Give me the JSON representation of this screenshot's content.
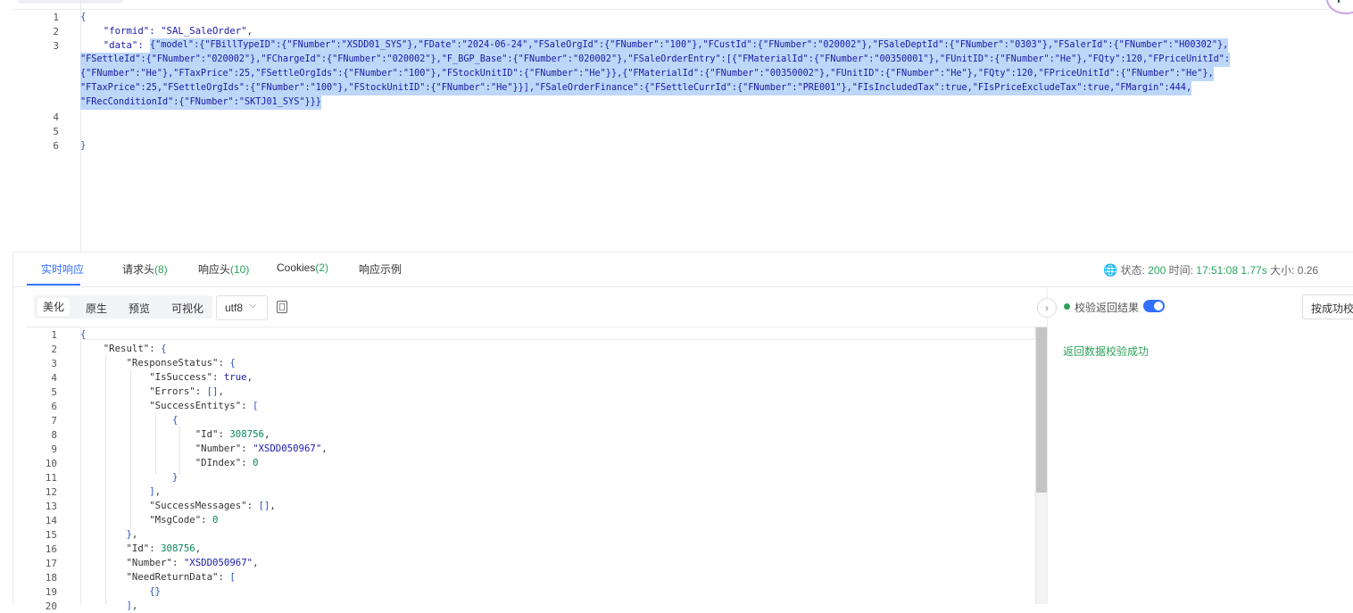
{
  "request": {
    "line_numbers": [
      "1",
      "2",
      "3",
      "4",
      "5",
      "6"
    ],
    "lines": [
      "{",
      "    \"formid\": \"SAL_SaleOrder\",",
      "    \"data\": ",
      "{\"model\":{\"FBillTypeID\":{\"FNumber\":\"XSDD01_SYS\"},\"FDate\":\"2024-06-24\",\"FSaleOrgId\":{\"FNumber\":\"100\"},\"FCustId\":{\"FNumber\":\"020002\"},\"FSaleDeptId\":{\"FNumber\":\"0303\"},\"FSalerId\":{\"FNumber\":\"H00302\"},",
      "\"FSettleId\":{\"FNumber\":\"020002\"},\"FChargeId\":{\"FNumber\":\"020002\"},\"F_BGP_Base\":{\"FNumber\":\"020002\"},\"FSaleOrderEntry\":[{\"FMaterialId\":{\"FNumber\":\"00350001\"},\"FUnitID\":{\"FNumber\":\"He\"},\"FQty\":120,\"FPriceUnitId\":",
      "{\"FNumber\":\"He\"},\"FTaxPrice\":25,\"FSettleOrgIds\":{\"FNumber\":\"100\"},\"FStockUnitID\":{\"FNumber\":\"He\"}},{\"FMaterialId\":{\"FNumber\":\"00350002\"},\"FUnitID\":{\"FNumber\":\"He\"},\"FQty\":120,\"FPriceUnitId\":{\"FNumber\":\"He\"},",
      "\"FTaxPrice\":25,\"FSettleOrgIds\":{\"FNumber\":\"100\"},\"FStockUnitID\":{\"FNumber\":\"He\"}}],\"FSaleOrderFinance\":{\"FSettleCurrId\":{\"FNumber\":\"PRE001\"},\"FIsIncludedTax\":true,\"FIsPriceExcludeTax\":true,\"FMargin\":444,",
      "\"FRecConditionId\":{\"FNumber\":\"SKTJ01_SYS\"}}}",
      "}"
    ]
  },
  "tabs": {
    "realtime": "实时响应",
    "req_headers": "请求头",
    "req_headers_count": "(8)",
    "resp_headers": "响应头",
    "resp_headers_count": "(10)",
    "cookies": "Cookies",
    "cookies_count": "(2)",
    "example": "响应示例"
  },
  "status": {
    "status_label": "状态:",
    "status_value": "200",
    "time_label": "时间:",
    "time_value": "17:51:08",
    "duration": "1.77s",
    "size_label": "大小:",
    "size_value": "0.26"
  },
  "toolbar": {
    "beautify": "美化",
    "raw": "原生",
    "preview": "预览",
    "visualize": "可视化",
    "encoding": "utf8"
  },
  "response": {
    "line_numbers": [
      "1",
      "2",
      "3",
      "4",
      "5",
      "6",
      "7",
      "8",
      "9",
      "10",
      "11",
      "12",
      "13",
      "14",
      "15",
      "16",
      "17",
      "18",
      "19",
      "20"
    ],
    "lines": [
      "{",
      "    \"Result\": {",
      "        \"ResponseStatus\": {",
      "            \"IsSuccess\": true,",
      "            \"Errors\": [],",
      "            \"SuccessEntitys\": [",
      "                {",
      "                    \"Id\": 308756,",
      "                    \"Number\": \"XSDD050967\",",
      "                    \"DIndex\": 0",
      "                }",
      "            ],",
      "            \"SuccessMessages\": [],",
      "            \"MsgCode\": 0",
      "        },",
      "        \"Id\": 308756,",
      "        \"Number\": \"XSDD050967\",",
      "        \"NeedReturnData\": [",
      "            {}",
      "        ],"
    ]
  },
  "validation": {
    "label": "校验返回结果",
    "enabled": true,
    "button": "按成功校",
    "message": "返回数据校验成功",
    "accent": "#2aa35a"
  },
  "colors": {
    "primary": "#3370ff",
    "selection": "#bcd7f7",
    "success": "#2aa35a"
  }
}
